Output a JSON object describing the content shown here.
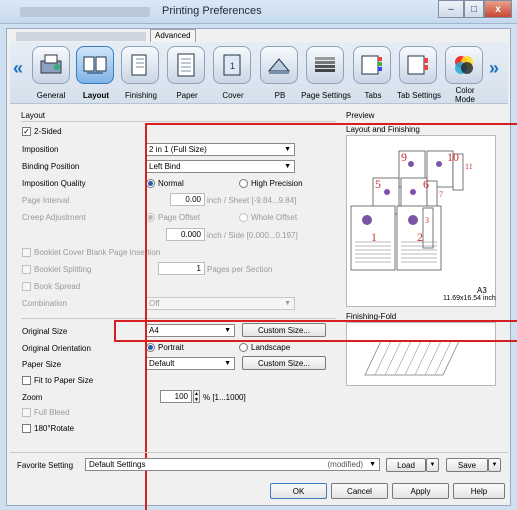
{
  "window": {
    "title": "Printing Preferences",
    "close": "x"
  },
  "tabs": {
    "advanced": "Advanced"
  },
  "toolbar": {
    "items": [
      "General",
      "Layout",
      "Finishing",
      "Paper",
      "Cover",
      "PB",
      "Page Settings",
      "Tabs",
      "Tab Settings",
      "Color Mode"
    ]
  },
  "layout": {
    "section": "Layout",
    "two_sided": "2-Sided",
    "imposition_label": "Imposition",
    "imposition_value": "2 in 1 (Full Size)",
    "binding_label": "Binding Position",
    "binding_value": "Left Bind",
    "quality_label": "Imposition Quality",
    "quality_normal": "Normal",
    "quality_high": "High Precision",
    "page_interval_label": "Page Interval",
    "page_interval_value": "0.00",
    "page_interval_unit": "inch / Sheet [-9.84...9.84]",
    "creep_label": "Creep Adjustment",
    "creep_page_offset": "Page Offset",
    "creep_whole_offset": "Whole Offset",
    "creep_value": "0.000",
    "creep_unit": "inch / Side [0.000...0.197]",
    "booklet_cover": "Booklet Cover Blank Page Insertion",
    "booklet_splitting": "Booklet Splitting",
    "booklet_pages_value": "1",
    "booklet_pages_unit": "Pages per Section",
    "book_spread": "Book Spread",
    "combination_label": "Combination",
    "combination_value": "Off",
    "original_size_label": "Original Size",
    "original_size_value": "A4",
    "custom_size": "Custom Size...",
    "orientation_label": "Original Orientation",
    "orientation_portrait": "Portrait",
    "orientation_landscape": "Landscape",
    "paper_size_label": "Paper Size",
    "paper_size_value": "Default",
    "fit_paper": "Fit to Paper Size",
    "zoom_label": "Zoom",
    "zoom_value": "100",
    "zoom_unit": "% [1...1000]",
    "full_bleed": "Full Bleed",
    "rotate": "180°Rotate"
  },
  "preview": {
    "section": "Preview",
    "layout_finishing": "Layout and Finishing",
    "paper_name": "A3",
    "paper_dims": "11.69x16.54 inch",
    "finishing_fold": "Finishing-Fold",
    "page_numbers": [
      "9",
      "10",
      "5",
      "6",
      "1",
      "2",
      "11",
      "7",
      "3"
    ]
  },
  "footer": {
    "favorite_label": "Favorite Setting",
    "favorite_value": "Default Settings",
    "modified": "(modified)",
    "load": "Load",
    "save": "Save",
    "ok": "OK",
    "cancel": "Cancel",
    "apply": "Apply",
    "help": "Help"
  },
  "colors": {
    "accent": "#1e5fae",
    "highlight": "#d42020"
  }
}
